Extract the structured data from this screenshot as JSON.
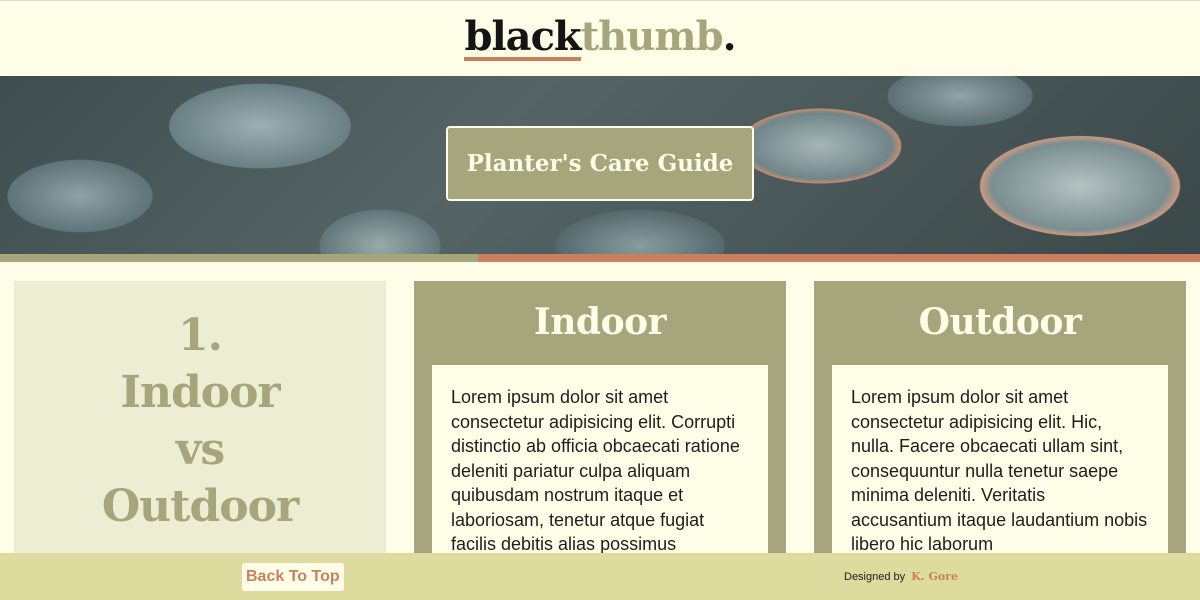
{
  "header": {
    "logo_part1": "black",
    "logo_part2": "thumb",
    "logo_dot": "."
  },
  "hero": {
    "title": "Planter's Care Guide"
  },
  "intro_card": {
    "number": "1.",
    "line1": "Indoor",
    "line2": "vs",
    "line3": "Outdoor"
  },
  "cards": [
    {
      "heading": "Indoor",
      "body": "Lorem ipsum dolor sit amet consectetur adipisicing elit. Corrupti distinctio ab officia obcaecati ratione deleniti pariatur culpa aliquam quibusdam nostrum itaque et laboriosam, tenetur atque fugiat facilis debitis alias possimus"
    },
    {
      "heading": "Outdoor",
      "body": "Lorem ipsum dolor sit amet consectetur adipisicing elit. Hic, nulla. Facere obcaecati ullam sint, consequuntur nulla tenetur saepe minima deleniti. Veritatis accusantium itaque laudantium nobis libero hic laborum"
    }
  ],
  "footer": {
    "back_to_top": "Back To Top",
    "designed_by": "Designed by",
    "author": "K. Gore"
  },
  "colors": {
    "olive": "#a7a57b",
    "terracotta": "#c9805e",
    "cream": "#fefde8",
    "footer_bg": "#dedb9e"
  }
}
